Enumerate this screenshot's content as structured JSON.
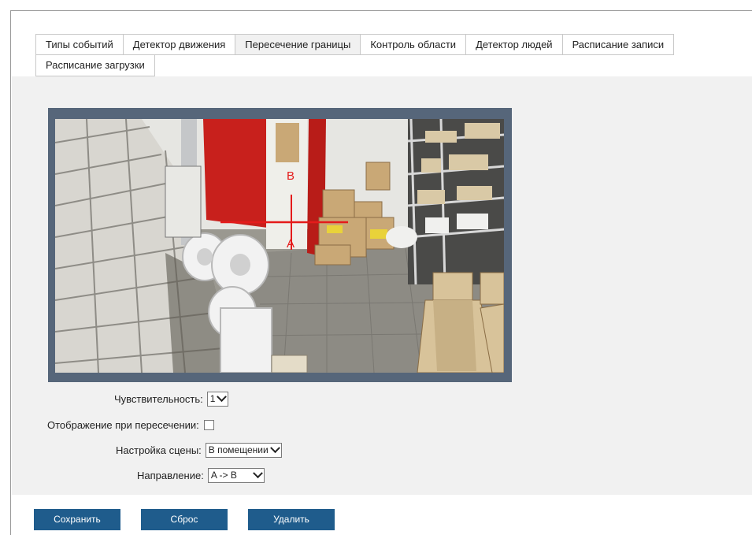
{
  "tabs": {
    "row1": [
      "Типы событий",
      "Детектор движения",
      "Пересечение границы",
      "Контроль области",
      "Детектор людей",
      "Расписание записи"
    ],
    "row2": [
      "Расписание загрузки"
    ],
    "active": "Пересечение границы"
  },
  "video": {
    "line_color": "#e41b1b",
    "label_a": "A",
    "label_b": "B"
  },
  "form": {
    "sensitivity_label": "Чувствительность:",
    "sensitivity_value": "1",
    "display_label": "Отображение при пересечении:",
    "display_checked": false,
    "scene_label": "Настройка сцены:",
    "scene_value": "В помещении",
    "direction_label": "Направление:",
    "direction_value": "A -> B"
  },
  "buttons": {
    "save": "Сохранить",
    "reset": "Сброс",
    "delete": "Удалить",
    "color": "#1f5c8c"
  }
}
